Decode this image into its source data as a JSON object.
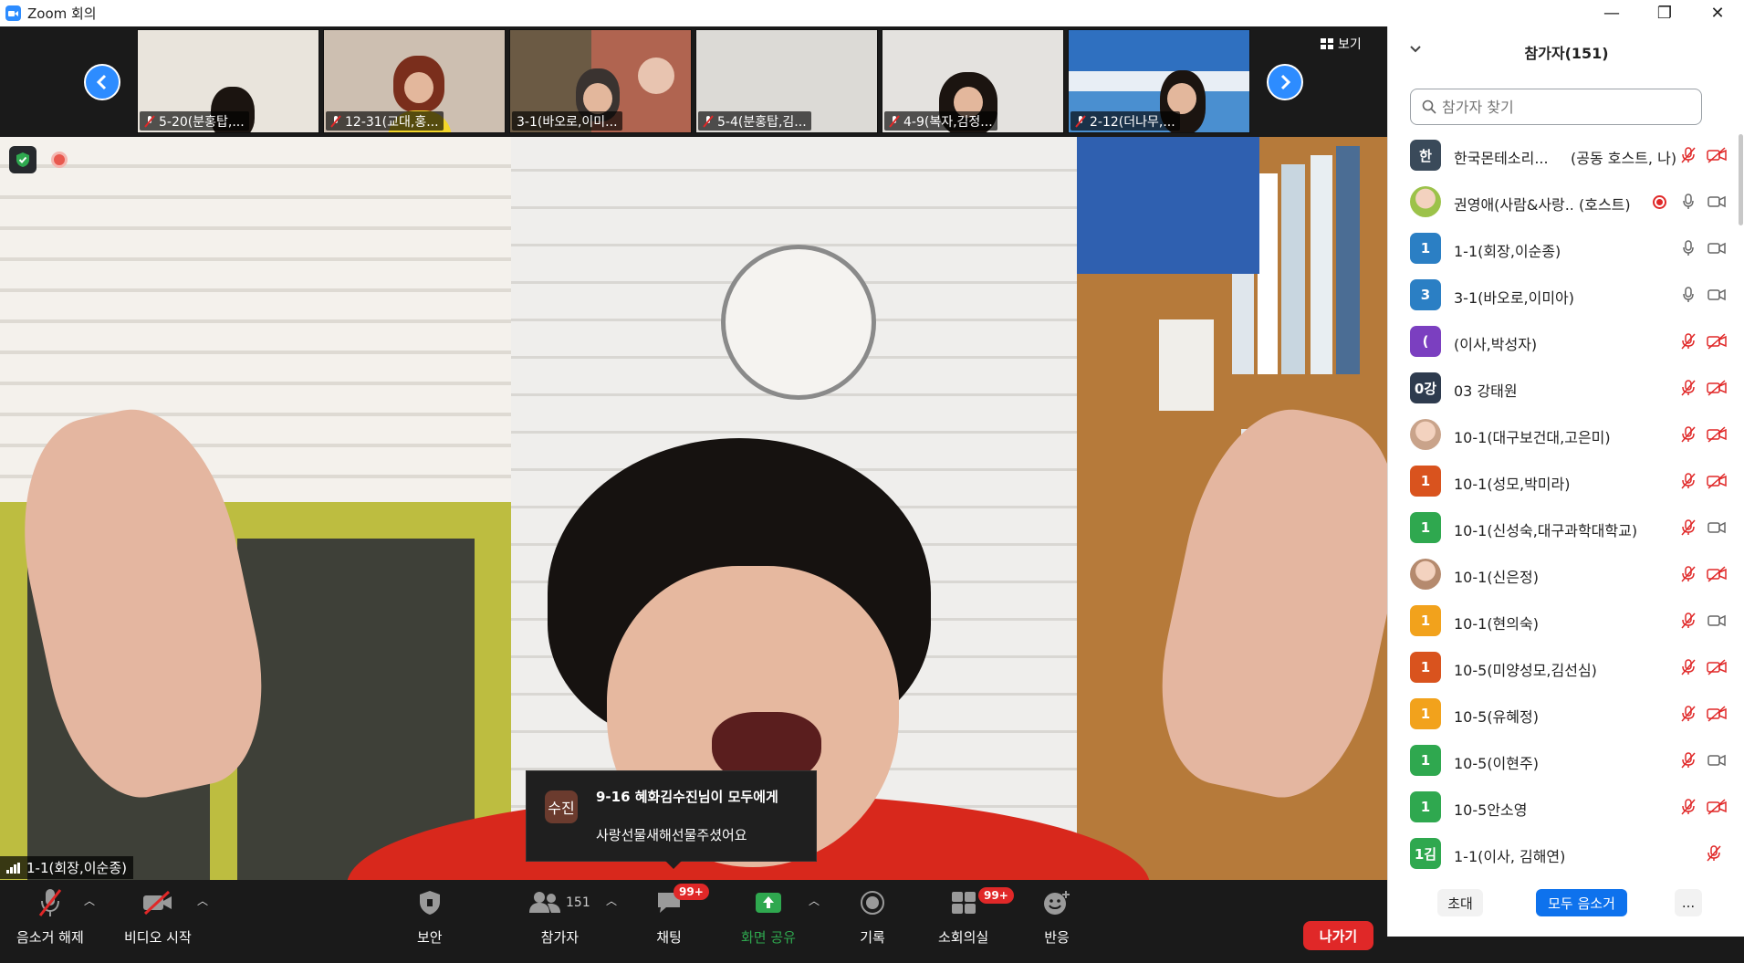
{
  "window": {
    "title": "Zoom 회의",
    "minimize": "—",
    "maximize": "❐",
    "close": "✕"
  },
  "strip": {
    "view_label": "보기",
    "thumbnails": [
      {
        "label": "5-20(분홍탑,...",
        "bg": "#e9e4dc"
      },
      {
        "label": "12-31(교대,홍...",
        "bg": "#cdbfb1"
      },
      {
        "label": "3-1(바오로,이미...",
        "bg": "#b06450"
      },
      {
        "label": "5-4(분홍탑,김...",
        "bg": "#dcdad6"
      },
      {
        "label": "4-9(복자,김정...",
        "bg": "#e4e2df"
      },
      {
        "label": "2-12(더나무,...",
        "bg": "#4a8fd0"
      }
    ]
  },
  "main": {
    "speaker_label": "1-1(회장,이순종)"
  },
  "toast": {
    "avatar": "수진",
    "from": "9-16 혜화김수진님이 모두에게",
    "message": "사랑선물새해선물주셨어요"
  },
  "toolbar": {
    "unmute": "음소거 해제",
    "start_video": "비디오 시작",
    "security": "보안",
    "participants": "참가자",
    "participants_count": "151",
    "chat": "채팅",
    "chat_badge": "99+",
    "share": "화면 공유",
    "record": "기록",
    "breakout": "소회의실",
    "breakout_badge": "99+",
    "reactions": "반응",
    "leave": "나가기"
  },
  "panel": {
    "title": "참가자(151)",
    "search_placeholder": "참가자 찾기",
    "participants": [
      {
        "avatar": "한",
        "color": "#3a4a5a",
        "name": "한국몬테소리...",
        "role": "(공동 호스트, 나)",
        "mic": "muted",
        "cam": "off",
        "rec": false
      },
      {
        "avatar": "",
        "color": "#9cc24a",
        "name": "권영애(사람&사랑...",
        "role": "(호스트)",
        "mic": "on",
        "cam": "on",
        "rec": true
      },
      {
        "avatar": "1",
        "color": "#2b7fc4",
        "name": "1-1(회장,이순종)",
        "role": "",
        "mic": "on",
        "cam": "on",
        "rec": false
      },
      {
        "avatar": "3",
        "color": "#2b7fc4",
        "name": "3-1(바오로,이미아)",
        "role": "",
        "mic": "on",
        "cam": "on",
        "rec": false
      },
      {
        "avatar": "(",
        "color": "#7b3fc0",
        "name": "(이사,박성자)",
        "role": "",
        "mic": "muted",
        "cam": "off",
        "rec": false
      },
      {
        "avatar": "0강",
        "color": "#2e3b4e",
        "name": "03 강태원",
        "role": "",
        "mic": "muted",
        "cam": "off",
        "rec": false
      },
      {
        "avatar": "",
        "color": "#c9a38a",
        "name": "10-1(대구보건대,고은미)",
        "role": "",
        "mic": "muted",
        "cam": "off",
        "rec": false
      },
      {
        "avatar": "1",
        "color": "#d9531e",
        "name": "10-1(성모,박미라)",
        "role": "",
        "mic": "muted",
        "cam": "off",
        "rec": false
      },
      {
        "avatar": "1",
        "color": "#2fa84f",
        "name": "10-1(신성숙,대구과학대학교)",
        "role": "",
        "mic": "muted",
        "cam": "on",
        "rec": false
      },
      {
        "avatar": "",
        "color": "#b58a6e",
        "name": "10-1(신은정)",
        "role": "",
        "mic": "muted",
        "cam": "off",
        "rec": false
      },
      {
        "avatar": "1",
        "color": "#f2a21c",
        "name": "10-1(현의숙)",
        "role": "",
        "mic": "muted",
        "cam": "on",
        "rec": false
      },
      {
        "avatar": "1",
        "color": "#d9531e",
        "name": "10-5(미양성모,김선심)",
        "role": "",
        "mic": "muted",
        "cam": "off",
        "rec": false
      },
      {
        "avatar": "1",
        "color": "#f2a21c",
        "name": "10-5(유혜정)",
        "role": "",
        "mic": "muted",
        "cam": "off",
        "rec": false
      },
      {
        "avatar": "1",
        "color": "#2fa84f",
        "name": "10-5(이현주)",
        "role": "",
        "mic": "muted",
        "cam": "on",
        "rec": false
      },
      {
        "avatar": "1",
        "color": "#2fa84f",
        "name": "10-5안소영",
        "role": "",
        "mic": "muted",
        "cam": "off",
        "rec": false
      },
      {
        "avatar": "1김",
        "color": "#2fa84f",
        "name": "1-1(이사, 김해연)",
        "role": "",
        "mic": "muted-only",
        "cam": "none",
        "rec": false
      }
    ],
    "invite": "초대",
    "mute_all": "모두 음소거",
    "more": "..."
  }
}
